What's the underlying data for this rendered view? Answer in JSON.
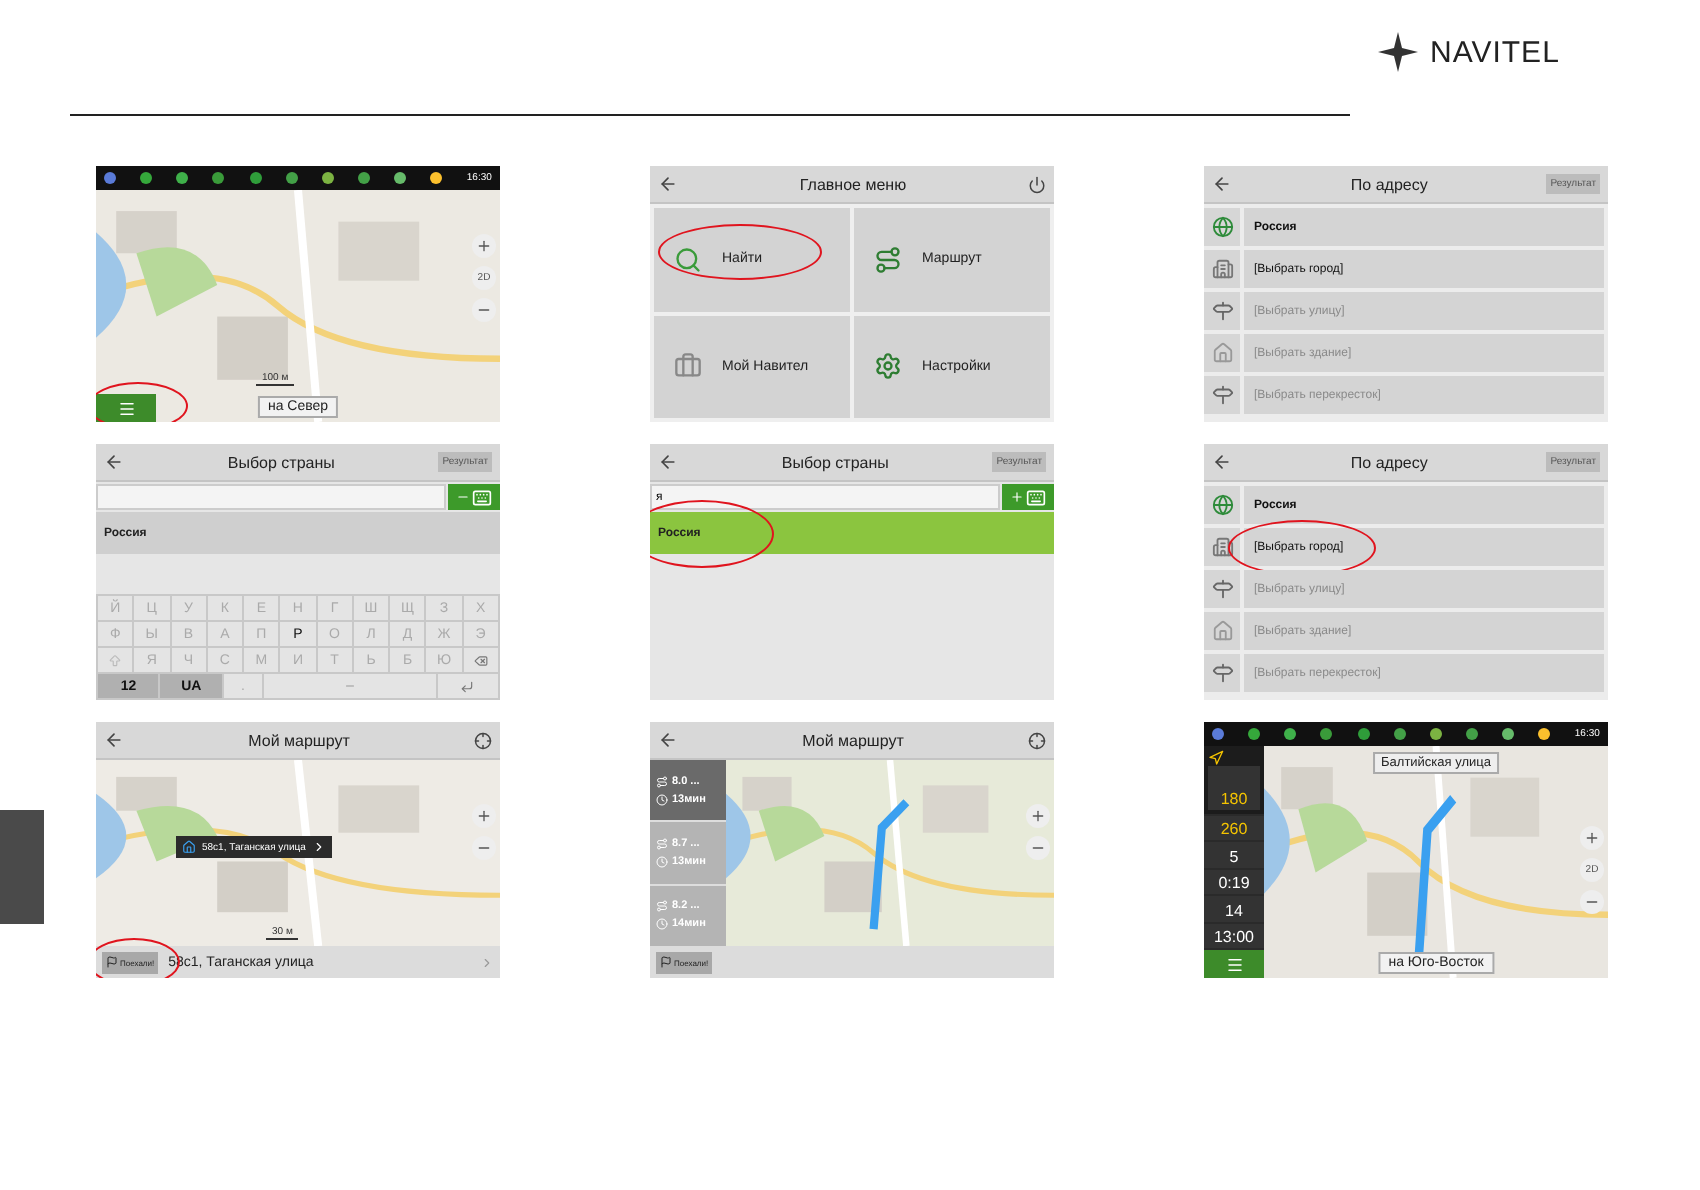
{
  "header": {
    "logo": "NAVITEL"
  },
  "panels": [
    {
      "kind": "map",
      "status_time": "16:30",
      "scale": "100 м",
      "direction": "на Север",
      "zoom_mode": "2D",
      "menu_highlighted": true
    },
    {
      "kind": "menu",
      "title": "Главное меню",
      "tiles": [
        {
          "label": "Найти",
          "highlighted": true
        },
        {
          "label": "Маршрут",
          "highlighted": false
        },
        {
          "label": "Мой Навител",
          "highlighted": false
        },
        {
          "label": "Настройки",
          "highlighted": false
        }
      ]
    },
    {
      "kind": "address",
      "title": "По адресу",
      "result_button": "Результат",
      "rows": [
        {
          "label": "Россия",
          "disabled": false,
          "highlighted": false
        },
        {
          "label": "[Выбрать город]",
          "disabled": false,
          "highlighted": false
        },
        {
          "label": "[Выбрать улицу]",
          "disabled": true,
          "highlighted": false
        },
        {
          "label": "[Выбрать здание]",
          "disabled": true,
          "highlighted": false
        },
        {
          "label": "[Выбрать перекресток]",
          "disabled": true,
          "highlighted": false
        }
      ]
    },
    {
      "kind": "search",
      "title": "Выбор страны",
      "result_button": "Результат",
      "results": [
        {
          "label": "Россия",
          "selected": false,
          "highlighted": false
        }
      ],
      "keyboard": [
        [
          {
            "kind": "char",
            "label": "Й",
            "disabled": true
          },
          {
            "kind": "char",
            "label": "Ц",
            "disabled": true
          },
          {
            "kind": "char",
            "label": "У",
            "disabled": true
          },
          {
            "kind": "char",
            "label": "К",
            "disabled": true
          },
          {
            "kind": "char",
            "label": "Е",
            "disabled": true
          },
          {
            "kind": "char",
            "label": "Н",
            "disabled": true
          },
          {
            "kind": "char",
            "label": "Г",
            "disabled": true
          },
          {
            "kind": "char",
            "label": "Ш",
            "disabled": true
          },
          {
            "kind": "char",
            "label": "Щ",
            "disabled": true
          },
          {
            "kind": "char",
            "label": "З",
            "disabled": true
          },
          {
            "kind": "char",
            "label": "Х",
            "disabled": true
          }
        ],
        [
          {
            "kind": "char",
            "label": "Ф",
            "disabled": true
          },
          {
            "kind": "char",
            "label": "Ы",
            "disabled": true
          },
          {
            "kind": "char",
            "label": "В",
            "disabled": true
          },
          {
            "kind": "char",
            "label": "А",
            "disabled": true
          },
          {
            "kind": "char",
            "label": "П",
            "disabled": true
          },
          {
            "kind": "char",
            "label": "Р",
            "disabled": false
          },
          {
            "kind": "char",
            "label": "О",
            "disabled": true
          },
          {
            "kind": "char",
            "label": "Л",
            "disabled": true
          },
          {
            "kind": "char",
            "label": "Д",
            "disabled": true
          },
          {
            "kind": "char",
            "label": "Ж",
            "disabled": true
          },
          {
            "kind": "char",
            "label": "Э",
            "disabled": true
          }
        ],
        [
          {
            "kind": "shift"
          },
          {
            "kind": "char",
            "label": "Я",
            "disabled": true
          },
          {
            "kind": "char",
            "label": "Ч",
            "disabled": true
          },
          {
            "kind": "char",
            "label": "С",
            "disabled": true
          },
          {
            "kind": "char",
            "label": "М",
            "disabled": true
          },
          {
            "kind": "char",
            "label": "И",
            "disabled": true
          },
          {
            "kind": "char",
            "label": "Т",
            "disabled": true
          },
          {
            "kind": "char",
            "label": "Ь",
            "disabled": true
          },
          {
            "kind": "char",
            "label": "Б",
            "disabled": true
          },
          {
            "kind": "char",
            "label": "Ю",
            "disabled": true
          },
          {
            "kind": "backspace"
          }
        ],
        [
          {
            "kind": "mode",
            "label": "12"
          },
          {
            "kind": "mode",
            "label": "UA"
          },
          {
            "kind": "char",
            "label": ".",
            "disabled": true
          },
          {
            "kind": "space"
          },
          {
            "kind": "enter"
          }
        ]
      ]
    },
    {
      "kind": "search",
      "title": "Выбор страны",
      "result_button": "Результат",
      "query": "я",
      "results": [
        {
          "label": "Россия",
          "selected": true,
          "highlighted": true
        }
      ]
    },
    {
      "kind": "address",
      "title": "По адресу",
      "result_button": "Результат",
      "rows": [
        {
          "label": "Россия",
          "disabled": false,
          "highlighted": false
        },
        {
          "label": "[Выбрать город]",
          "disabled": false,
          "highlighted": true
        },
        {
          "label": "[Выбрать улицу]",
          "disabled": true,
          "highlighted": false
        },
        {
          "label": "[Выбрать здание]",
          "disabled": true,
          "highlighted": false
        },
        {
          "label": "[Выбрать перекресток]",
          "disabled": true,
          "highlighted": false
        }
      ]
    },
    {
      "kind": "route_map",
      "title": "Мой маршрут",
      "popup": "58с1, Таганская улица",
      "scale": "30 м",
      "go_button": "Поехали!",
      "destination": "58с1, Таганская улица",
      "go_highlighted": true
    },
    {
      "kind": "route_options",
      "title": "Мой маршрут",
      "options": [
        {
          "distance": "8.0 ...",
          "time": "13мин",
          "selected": true
        },
        {
          "distance": "8.7 ...",
          "time": "13мин",
          "selected": false
        },
        {
          "distance": "8.2 ...",
          "time": "14мин",
          "selected": false
        }
      ],
      "go_button": "Поехали!"
    },
    {
      "kind": "guidance",
      "status_time": "16:30",
      "street": "Балтийская улица",
      "direction": "на Юго-Восток",
      "zoom_mode": "2D",
      "info": [
        {
          "kind": "turn",
          "value": "180"
        },
        {
          "kind": "next",
          "value": "260"
        },
        {
          "kind": "stat",
          "value": "5"
        },
        {
          "kind": "stat",
          "value": "0:19"
        },
        {
          "kind": "stat",
          "value": "14"
        },
        {
          "kind": "stat",
          "value": "13:00"
        }
      ]
    }
  ]
}
